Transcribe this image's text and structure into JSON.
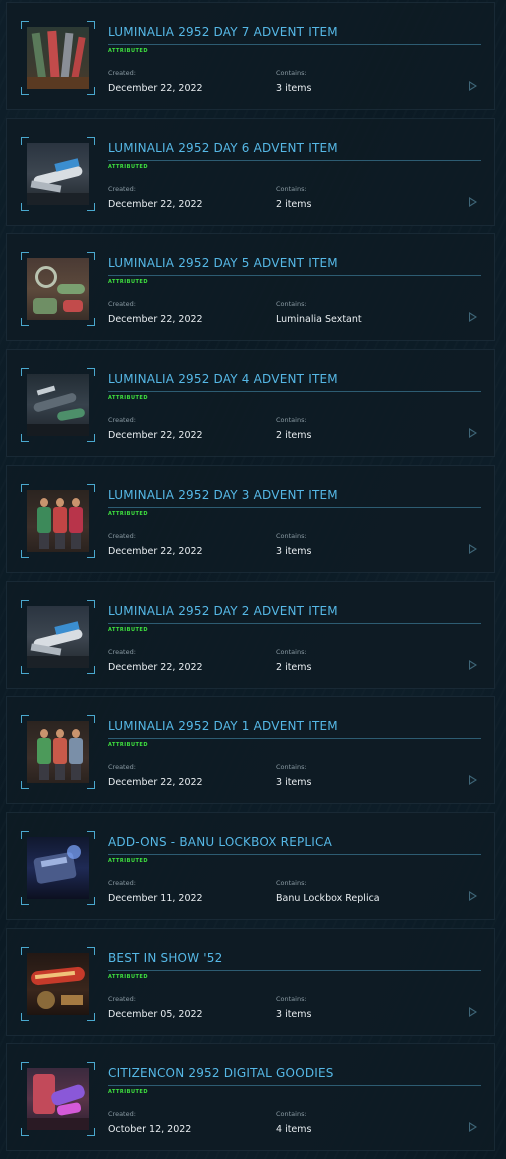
{
  "labels": {
    "created": "Created:",
    "contains": "Contains:"
  },
  "items": [
    {
      "title": "LUMINALIA 2952 DAY 7 ADVENT ITEM",
      "status": "ATTRIBUTED",
      "created": "December 22, 2022",
      "contains": "3 items",
      "thumb": "weapons"
    },
    {
      "title": "LUMINALIA 2952 DAY 6 ADVENT ITEM",
      "status": "ATTRIBUTED",
      "created": "December 22, 2022",
      "contains": "2 items",
      "thumb": "ship-white"
    },
    {
      "title": "LUMINALIA 2952 DAY 5 ADVENT ITEM",
      "status": "ATTRIBUTED",
      "created": "December 22, 2022",
      "contains": "Luminalia Sextant",
      "thumb": "sextant"
    },
    {
      "title": "LUMINALIA 2952 DAY 4 ADVENT ITEM",
      "status": "ATTRIBUTED",
      "created": "December 22, 2022",
      "contains": "2 items",
      "thumb": "ship-dark"
    },
    {
      "title": "LUMINALIA 2952 DAY 3 ADVENT ITEM",
      "status": "ATTRIBUTED",
      "created": "December 22, 2022",
      "contains": "3 items",
      "thumb": "people-3"
    },
    {
      "title": "LUMINALIA 2952 DAY 2 ADVENT ITEM",
      "status": "ATTRIBUTED",
      "created": "December 22, 2022",
      "contains": "2 items",
      "thumb": "ship-white"
    },
    {
      "title": "LUMINALIA 2952 DAY 1 ADVENT ITEM",
      "status": "ATTRIBUTED",
      "created": "December 22, 2022",
      "contains": "3 items",
      "thumb": "people-3b"
    },
    {
      "title": "ADD-ONS - BANU LOCKBOX REPLICA",
      "status": "ATTRIBUTED",
      "created": "December 11, 2022",
      "contains": "Banu Lockbox Replica",
      "thumb": "lockbox"
    },
    {
      "title": "BEST IN SHOW '52",
      "status": "ATTRIBUTED",
      "created": "December 05, 2022",
      "contains": "3 items",
      "thumb": "trophy"
    },
    {
      "title": "CITIZENCON 2952 DIGITAL GOODIES",
      "status": "ATTRIBUTED",
      "created": "October 12, 2022",
      "contains": "4 items",
      "thumb": "goodies"
    }
  ],
  "colors": {
    "title": "#56b8e6",
    "attributed": "#3fe13f",
    "background": "#0b1a24",
    "card": "#0e1b24",
    "corner": "#4aa9cf"
  },
  "icons": {
    "open": "play-arrow-icon"
  }
}
